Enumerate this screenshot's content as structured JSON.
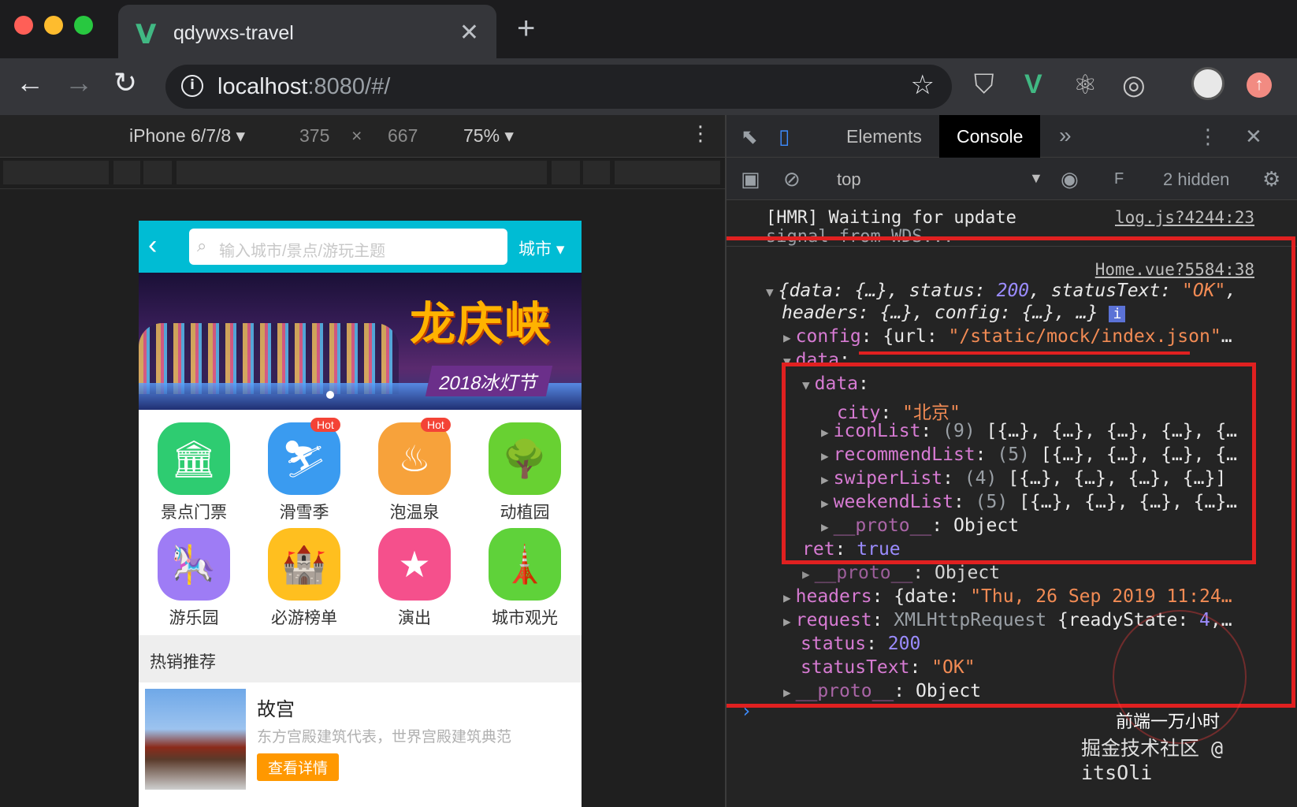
{
  "browser": {
    "tab_title": "qdywxs-travel",
    "url_host": "localhost",
    "url_rest": ":8080/#/"
  },
  "device_toolbar": {
    "device": "iPhone 6/7/8",
    "width": "375",
    "times": "×",
    "height": "667",
    "zoom": "75%"
  },
  "mobile_page": {
    "search_placeholder": "输入城市/景点/游玩主题",
    "city_label": "城市",
    "banner_brand": "龙庆峡",
    "banner_sub": "2018冰灯节",
    "icons": [
      {
        "label": "景点门票",
        "icon": "temple-icon",
        "glyph": "🏛",
        "color": "#2ecc71",
        "hot": ""
      },
      {
        "label": "滑雪季",
        "icon": "ski-icon",
        "glyph": "⛷",
        "color": "#3a9bf0",
        "hot": "Hot"
      },
      {
        "label": "泡温泉",
        "icon": "hot-spring-icon",
        "glyph": "♨",
        "color": "#f7a23b",
        "hot": "Hot"
      },
      {
        "label": "动植园",
        "icon": "zoo-icon",
        "glyph": "🌳",
        "color": "#68d132",
        "hot": ""
      },
      {
        "label": "游乐园",
        "icon": "carousel-icon",
        "glyph": "🎠",
        "color": "#9e7cf5",
        "hot": ""
      },
      {
        "label": "必游榜单",
        "icon": "castle-icon",
        "glyph": "🏰",
        "color": "#ffbf1f",
        "hot": ""
      },
      {
        "label": "演出",
        "icon": "theater-icon",
        "glyph": "★",
        "color": "#f5508c",
        "hot": ""
      },
      {
        "label": "城市观光",
        "icon": "tower-icon",
        "glyph": "🗼",
        "color": "#5fd23a",
        "hot": ""
      }
    ],
    "section_title": "热销推荐",
    "recommend": {
      "name": "故宫",
      "desc": "东方宫殿建筑代表，世界宫殿建筑典范",
      "button": "查看详情"
    }
  },
  "devtools": {
    "tabs": [
      "Elements",
      "Console"
    ],
    "more": "»",
    "context": "top",
    "hidden": "2 hidden",
    "filter_stub": "F"
  },
  "console": {
    "hmr_msg": "[HMR] Waiting for update",
    "hmr_msg2": "signal from WDS...",
    "hmr_src": "log.js?4244:23",
    "home_src": "Home.vue?5584:38",
    "line1_a": "{data: {…}, status: ",
    "line1_status": "200",
    "line1_b": ", statusText: ",
    "line1_text": "\"OK\"",
    "line1_c": ",",
    "line2": "headers: {…}, config: {…}, …}",
    "config_key": "config",
    "config_val_a": ": {url: ",
    "config_url": "\"/static/mock/index.json\"",
    "config_tail": "…",
    "data_key": "data",
    "inner_data_key": "data",
    "city_key": "city",
    "city_val": "\"北京\"",
    "iconList_key": "iconList",
    "iconList_count": "(9)",
    "iconList_val": "[{…}, {…}, {…}, {…}, {…",
    "recommendList_key": "recommendList",
    "recommendList_count": "(5)",
    "recommendList_val": "[{…}, {…}, {…}, {…",
    "swiperList_key": "swiperList",
    "swiperList_count": "(4)",
    "swiperList_val": "[{…}, {…}, {…}, {…}]",
    "weekendList_key": "weekendList",
    "weekendList_count": "(5)",
    "weekendList_val": "[{…}, {…}, {…}, {…}…",
    "proto_key": "__proto__",
    "proto_val": "Object",
    "ret_key": "ret",
    "ret_val": "true",
    "headers_key": "headers",
    "headers_val_a": ": {date: ",
    "headers_date": "\"Thu, 26 Sep 2019 11:24…",
    "request_key": "request",
    "request_val": "XMLHttpRequest",
    "request_tail": " {readyState: ",
    "request_state": "4",
    "request_end": ",…",
    "status_key": "status",
    "status_val": "200",
    "statusText_key": "statusText",
    "statusText_val": "\"OK\"",
    "prompt": "›"
  },
  "watermark": {
    "line1": "前端一万小时",
    "line2": "掘金技术社区 @ itsOli"
  },
  "colors": {
    "accent_cyan": "#00bcd4",
    "highlight_red": "#e02020"
  }
}
